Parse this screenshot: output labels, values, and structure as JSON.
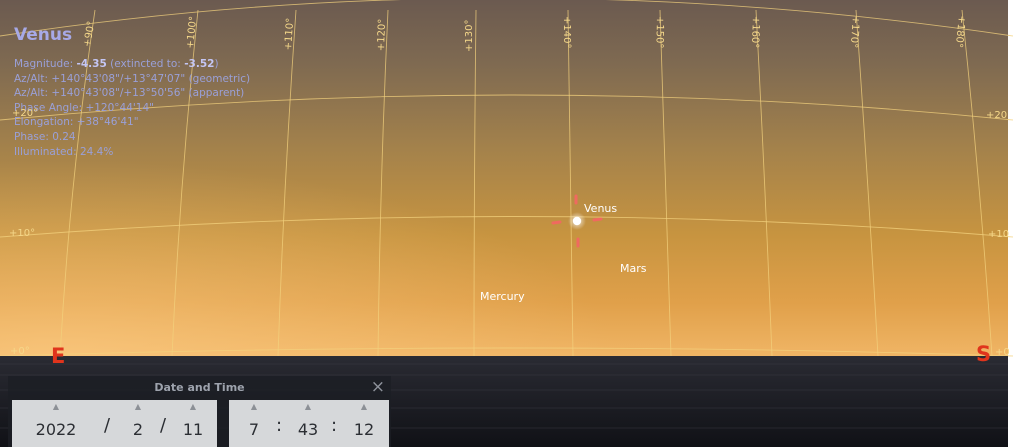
{
  "object": {
    "name": "Venus",
    "magnitude_label": "Magnitude:",
    "magnitude": "-4.35",
    "extincted_label": "(extincted to:",
    "extincted": "-3.52",
    "extincted_close": ")",
    "azalt_geometric": "Az/Alt: +140°43'08\"/+13°47'07\" (geometric)",
    "azalt_apparent": "Az/Alt: +140°43'08\"/+13°50'56\" (apparent)",
    "phase_angle": "Phase Angle: +120°44'14\"",
    "elongation": "Elongation: +38°46'41\"",
    "phase": "Phase: 0.24",
    "illuminated": "Illuminated: 24.4%"
  },
  "planets": {
    "venus": "Venus",
    "mars": "Mars",
    "mercury": "Mercury"
  },
  "cardinals": {
    "east": "E",
    "south": "S"
  },
  "altitude_labels": {
    "alt20_left": "+20°",
    "alt20_right": "+20",
    "alt10_left": "+10°",
    "alt10_right": "+10",
    "alt0_left": "+0°",
    "alt0_right": "+0"
  },
  "azimuth_labels": [
    "+90°",
    "+100°",
    "+110°",
    "+120°",
    "+130°",
    "+140°",
    "+150°",
    "+160°",
    "+170°",
    "+180°"
  ],
  "datetime": {
    "title": "Date and Time",
    "close": "×",
    "year": "2022",
    "month": "2",
    "day": "11",
    "hour": "7",
    "minute": "43",
    "second": "12",
    "date_sep": "/",
    "time_sep": ":"
  },
  "colors": {
    "cardinal": "#e0341c",
    "grid": "#f5d88a",
    "info_text": "#9aa0d8"
  }
}
